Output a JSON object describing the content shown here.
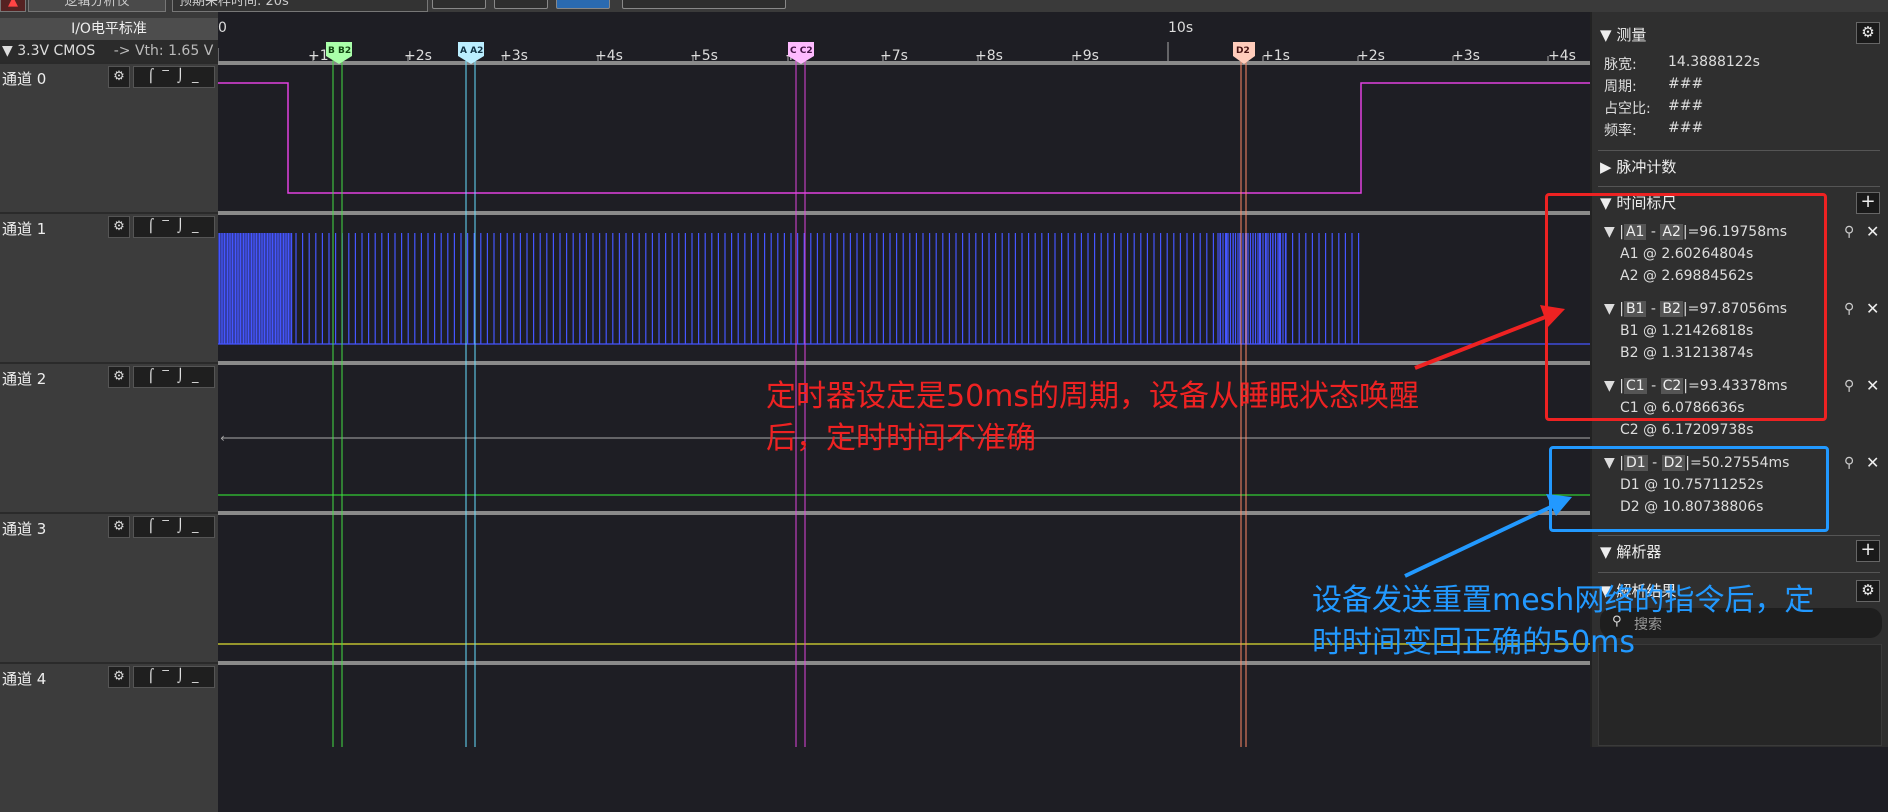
{
  "top": {
    "tab_label": "逻辑分析仪",
    "sample_time": "预期采样时间: 20s"
  },
  "left": {
    "io_header": "I/O电平标准",
    "io_standard": "▼ 3.3V CMOS",
    "vth": "-> Vth: 1.65 V",
    "channels": [
      "通道 0",
      "通道 1",
      "通道 2",
      "通道 3",
      "通道 4"
    ]
  },
  "timeline": {
    "ticks": [
      "0",
      "+1",
      "+2s",
      "+3s",
      "+4s",
      "+5s",
      "+6",
      "+7s",
      "+8s",
      "+9s",
      "10s",
      "+1s",
      "+2s",
      "+3s",
      "+4s"
    ],
    "markers": [
      "B B2",
      "A A2",
      "C C2",
      "D2"
    ]
  },
  "right": {
    "measure_title": "测量",
    "pulse_width_label": "脉宽:",
    "pulse_width": "14.3888122s",
    "period_label": "周期:",
    "period": "###",
    "duty_label": "占空比:",
    "duty": "###",
    "freq_label": "频率:",
    "freq": "###",
    "pulse_count": "脉冲计数",
    "ruler_title": "时间标尺",
    "rulers": [
      {
        "a": "A1",
        "b": "A2",
        "delta": "|=96.19758ms",
        "l1": "A1 @ 2.60264804s",
        "l2": "A2 @ 2.69884562s"
      },
      {
        "a": "B1",
        "b": "B2",
        "delta": "|=97.87056ms",
        "l1": "B1 @ 1.21426818s",
        "l2": "B2 @ 1.31213874s"
      },
      {
        "a": "C1",
        "b": "C2",
        "delta": "|=93.43378ms",
        "l1": "C1 @ 6.0786636s",
        "l2": "C2 @ 6.17209738s"
      },
      {
        "a": "D1",
        "b": "D2",
        "delta": "|=50.27554ms",
        "l1": "D1 @ 10.75711252s",
        "l2": "D2 @ 10.80738806s"
      }
    ],
    "analyzer_title": "解析器",
    "decode_title": "解析结果",
    "search_placeholder": "搜索"
  },
  "notes": {
    "red_line1": "定时器设定是50ms的周期，设备从睡眠状态唤醒",
    "red_line2": "后，定时时间不准确",
    "blue_line1": "设备发送重置mesh网络的指令后，定",
    "blue_line2": "时时间变回正确的50ms"
  },
  "colors": {
    "ch0": "#e040e0",
    "ch1": "#4455ff",
    "ch2": "#33cc33",
    "ch3": "#dddd33",
    "red_note": "#ee2222",
    "blue_note": "#2299ff"
  }
}
